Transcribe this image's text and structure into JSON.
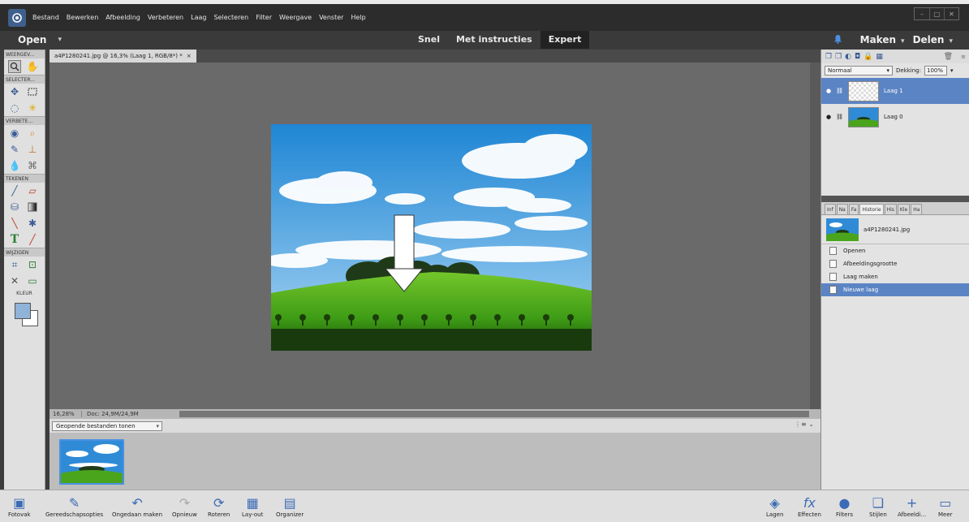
{
  "menubar": {
    "items": [
      "Bestand",
      "Bewerken",
      "Afbeelding",
      "Verbeteren",
      "Laag",
      "Selecteren",
      "Filter",
      "Weergave",
      "Venster",
      "Help"
    ]
  },
  "modebar": {
    "open_label": "Open",
    "modes": [
      "Snel",
      "Met instructies",
      "Expert"
    ],
    "active_mode": "Expert",
    "create_label": "Maken",
    "share_label": "Delen"
  },
  "toolbox": {
    "sections": [
      "WEERGEV...",
      "SELECTER...",
      "VERBETE...",
      "TEKENEN",
      "WIJZIGEN",
      "KLEUR"
    ],
    "fg_color": "#8fb3d9",
    "bg_color": "#ffffff"
  },
  "document": {
    "tab_title": "a4P1280241.jpg @ 16,3% (Laag 1, RGB/8*) *",
    "zoom": "16,28%",
    "doc_size": "Doc: 24,9M/24,9M"
  },
  "photobin": {
    "select_value": "Geopende bestanden tonen"
  },
  "layers": {
    "blend_mode": "Normaal",
    "opacity_label": "Dekking:",
    "opacity_value": "100%",
    "items": [
      {
        "name": "Laag 1",
        "selected": true
      },
      {
        "name": "Laag 0",
        "selected": false
      }
    ]
  },
  "history": {
    "tabs": [
      "Inf",
      "Na",
      "Fa",
      "Historie",
      "His",
      "Kle",
      "Ha"
    ],
    "active_tab": "Historie",
    "snapshot": "a4P1280241.jpg",
    "steps": [
      {
        "label": "Openen",
        "selected": false
      },
      {
        "label": "Afbeeldingsgrootte",
        "selected": false
      },
      {
        "label": "Laag maken",
        "selected": false
      },
      {
        "label": "Nieuwe laag",
        "selected": true
      }
    ]
  },
  "bottombar": {
    "left": [
      "Fotovak",
      "Gereedschapsopties",
      "Ongedaan maken",
      "Opnieuw",
      "Roteren",
      "Lay-out",
      "Organizer"
    ],
    "right": [
      "Lagen",
      "Effecten",
      "Filters",
      "Stijlen",
      "Afbeeldi...",
      "Meer"
    ]
  }
}
